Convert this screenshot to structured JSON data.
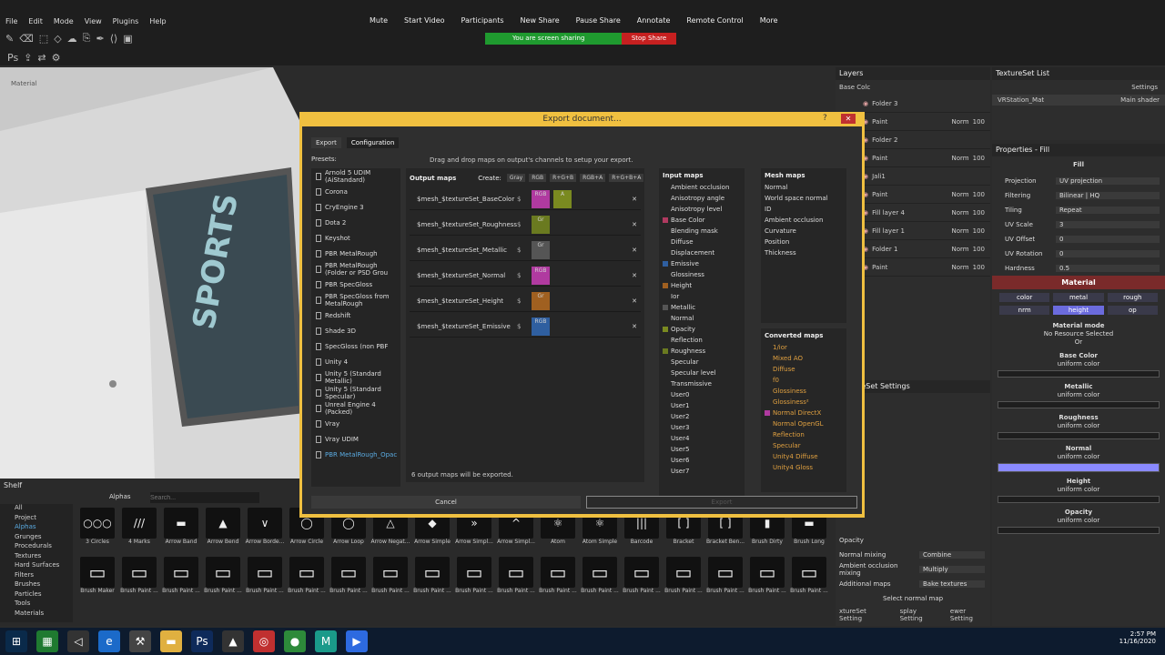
{
  "menu": [
    "File",
    "Edit",
    "Mode",
    "View",
    "Plugins",
    "Help"
  ],
  "zoom_bar": [
    "Mute",
    "Start Video",
    "Participants",
    "New Share",
    "Pause Share",
    "Annotate",
    "Remote Control",
    "More"
  ],
  "share": {
    "message": "You are screen sharing",
    "stop": "Stop Share"
  },
  "viewport": {
    "label": "Material"
  },
  "dialog": {
    "title": "Export document...",
    "help": "?",
    "close": "✕",
    "tabs": [
      "Export",
      "Configuration"
    ],
    "hint": "Drag and drop maps on output's channels to setup your export.",
    "presets_label": "Presets:",
    "presets": [
      "Arnold 5 UDIM (AiStandard)",
      "Corona",
      "CryEngine 3",
      "Dota 2",
      "Keyshot",
      "PBR MetalRough",
      "PBR MetalRough (Folder or PSD Grou",
      "PBR SpecGloss",
      "PBR SpecGloss from MetalRough",
      "Redshift",
      "Shade 3D",
      "SpecGloss (non PBF",
      "Unity 4",
      "Unity 5 (Standard Metallic)",
      "Unity 5 (Standard Specular)",
      "Unreal Engine 4 (Packed)",
      "Vray",
      "Vray UDIM",
      "PBR MetalRough_Opac"
    ],
    "outputs_title": "Output maps",
    "create_label": "Create:",
    "formats": [
      "Gray",
      "RGB",
      "R+G+B",
      "RGB+A",
      "R+G+B+A"
    ],
    "outputs": [
      {
        "name": "$mesh_$textureSet_BaseColor",
        "s": "$",
        "channels": [
          {
            "t": "RGB",
            "c": "#b03aa0"
          },
          {
            "t": "A",
            "c": "#7a8a20"
          }
        ]
      },
      {
        "name": "$mesh_$textureSet_Roughness",
        "s": "$",
        "channels": [
          {
            "t": "Gr",
            "c": "#6a7a20"
          }
        ]
      },
      {
        "name": "$mesh_$textureSet_Metallic",
        "s": "$",
        "channels": [
          {
            "t": "Gr",
            "c": "#555555"
          }
        ]
      },
      {
        "name": "$mesh_$textureSet_Normal",
        "s": "$",
        "channels": [
          {
            "t": "RGB",
            "c": "#b03aa0"
          }
        ]
      },
      {
        "name": "$mesh_$textureSet_Height",
        "s": "$",
        "channels": [
          {
            "t": "Gr",
            "c": "#a06020"
          }
        ]
      },
      {
        "name": "$mesh_$textureSet_Emissive",
        "s": "$",
        "channels": [
          {
            "t": "RGB",
            "c": "#2f5fa0"
          }
        ]
      }
    ],
    "output_count": "6 output maps will be exported.",
    "inputs_title": "Input maps",
    "inputs": [
      {
        "n": "Ambient occlusion",
        "c": ""
      },
      {
        "n": "Anisotropy angle",
        "c": ""
      },
      {
        "n": "Anisotropy level",
        "c": ""
      },
      {
        "n": "Base Color",
        "c": "#b03a60"
      },
      {
        "n": "Blending mask",
        "c": ""
      },
      {
        "n": "Diffuse",
        "c": ""
      },
      {
        "n": "Displacement",
        "c": ""
      },
      {
        "n": "Emissive",
        "c": "#2f5fa0"
      },
      {
        "n": "Glossiness",
        "c": ""
      },
      {
        "n": "Height",
        "c": "#a06020"
      },
      {
        "n": "Ior",
        "c": ""
      },
      {
        "n": "Metallic",
        "c": "#555555"
      },
      {
        "n": "Normal",
        "c": ""
      },
      {
        "n": "Opacity",
        "c": "#7a8a20"
      },
      {
        "n": "Reflection",
        "c": ""
      },
      {
        "n": "Roughness",
        "c": "#6a7a20"
      },
      {
        "n": "Specular",
        "c": ""
      },
      {
        "n": "Specular level",
        "c": ""
      },
      {
        "n": "Transmissive",
        "c": ""
      },
      {
        "n": "User0",
        "c": ""
      },
      {
        "n": "User1",
        "c": ""
      },
      {
        "n": "User2",
        "c": ""
      },
      {
        "n": "User3",
        "c": ""
      },
      {
        "n": "User4",
        "c": ""
      },
      {
        "n": "User5",
        "c": ""
      },
      {
        "n": "User6",
        "c": ""
      },
      {
        "n": "User7",
        "c": ""
      }
    ],
    "mesh_title": "Mesh maps",
    "mesh": [
      "Normal",
      "World space normal",
      "ID",
      "Ambient occlusion",
      "Curvature",
      "Position",
      "Thickness"
    ],
    "conv_title": "Converted maps",
    "conv": [
      "1/ior",
      "Mixed AO",
      "Diffuse",
      "f0",
      "Glossiness",
      "Glossiness²",
      "Normal DirectX",
      "Normal OpenGL",
      "Reflection",
      "Specular",
      "Unity4 Diffuse",
      "Unity4 Gloss"
    ],
    "cancel": "Cancel",
    "export": "Export"
  },
  "layers": {
    "title": "Layers",
    "blend": "Base Colc",
    "rows": [
      {
        "name": "Folder 3",
        "mode": "",
        "val": ""
      },
      {
        "name": "Paint",
        "mode": "Norm",
        "val": "100"
      },
      {
        "name": "Folder 2",
        "mode": "",
        "val": ""
      },
      {
        "name": "Paint",
        "mode": "Norm",
        "val": "100"
      },
      {
        "name": "Jali1",
        "mode": "",
        "val": ""
      },
      {
        "name": "Paint",
        "mode": "Norm",
        "val": "100"
      },
      {
        "name": "Fill layer 4",
        "mode": "Norm",
        "val": "100"
      },
      {
        "name": "Fill layer 1",
        "mode": "Norm",
        "val": "100"
      },
      {
        "name": "Folder 1",
        "mode": "Norm",
        "val": "100"
      },
      {
        "name": "Paint",
        "mode": "Norm",
        "val": "100"
      }
    ]
  },
  "texset": {
    "title": "TextureSet List",
    "settings": "Settings",
    "item": "VRStation_Mat",
    "shader": "Main shader"
  },
  "props": {
    "title": "Properties - Fill",
    "fill": "Fill",
    "rows": [
      {
        "k": "Projection",
        "v": "UV projection"
      },
      {
        "k": "Filtering",
        "v": "Bilinear | HQ"
      },
      {
        "k": "Tiling",
        "v": "Repeat"
      },
      {
        "k": "UV Scale",
        "v": "3"
      },
      {
        "k": "UV Offset",
        "v": "0"
      },
      {
        "k": "UV Rotation",
        "v": "0"
      },
      {
        "k": "Hardness",
        "v": "0.5"
      }
    ],
    "material": "Material",
    "chips": [
      "color",
      "metal",
      "rough",
      "nrm",
      "height",
      "op"
    ],
    "mode_title": "Material mode",
    "mode_val": "No Resource Selected",
    "or": "Or",
    "sections": [
      {
        "t": "Base Color",
        "s": "uniform color"
      },
      {
        "t": "Metallic",
        "s": "uniform color"
      },
      {
        "t": "Roughness",
        "s": "uniform color"
      },
      {
        "t": "Normal",
        "s": "uniform color"
      },
      {
        "t": "Height",
        "s": "uniform color"
      },
      {
        "t": "Opacity",
        "s": "uniform color"
      }
    ]
  },
  "tss": {
    "title": "TextureSet Settings",
    "rows": [
      {
        "k": "Opacity",
        "v": ""
      },
      {
        "k": "Normal mixing",
        "v": "Combine"
      },
      {
        "k": "Ambient occlusion mixing",
        "v": "Multiply"
      },
      {
        "k": "Additional maps",
        "v": "Bake textures"
      }
    ],
    "select_normal": "Select normal map",
    "bottom_tabs": [
      "xtureSet Setting",
      "splay Setting",
      "ewer Setting"
    ]
  },
  "shelf": {
    "title": "Shelf",
    "filter": "Alphas",
    "search_placeholder": "Search...",
    "cats": [
      "All",
      "Project",
      "Alphas",
      "Grunges",
      "Procedurals",
      "Textures",
      "Hard Surfaces",
      "Filters",
      "Brushes",
      "Particles",
      "Tools",
      "Materials"
    ],
    "items": [
      "3 Circles",
      "4 Marks",
      "Arrow Band",
      "Arrow Bend",
      "Arrow Borde...",
      "Arrow Circle",
      "Arrow Loop",
      "Arrow Negat...",
      "Arrow Simple",
      "Arrow Simpl...",
      "Arrow Simpl...",
      "Atom",
      "Atom Simple",
      "Barcode",
      "Bracket",
      "Bracket Ben...",
      "Brush Dirty",
      "Brush Long",
      "Brush Maker",
      "Brush Paint ...",
      "Brush Paint ...",
      "Brush Paint ...",
      "Brush Paint ...",
      "Brush Paint ...",
      "Brush Paint ...",
      "Brush Paint ...",
      "Brush Paint ...",
      "Brush Paint ...",
      "Brush Paint ...",
      "Brush Paint ...",
      "Brush Paint ...",
      "Brush Paint ...",
      "Brush Paint ...",
      "Brush Paint ...",
      "Brush Paint ...",
      "Brush Paint ..."
    ]
  },
  "clock": {
    "time": "2:57 PM",
    "date": "11/16/2020"
  }
}
